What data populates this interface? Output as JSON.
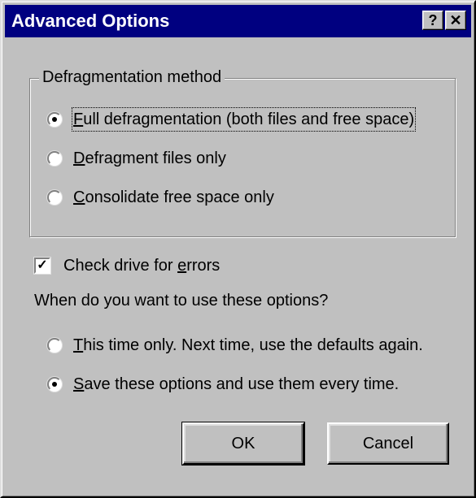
{
  "window": {
    "title": "Advanced Options",
    "help_label": "?",
    "close_label": "✕"
  },
  "method_group": {
    "legend": "Defragmentation method",
    "options": [
      {
        "accel": "F",
        "rest": "ull defragmentation (both files and free space)",
        "selected": true
      },
      {
        "accel": "D",
        "rest": "efragment files only",
        "selected": false
      },
      {
        "accel": "C",
        "rest": "onsolidate free space only",
        "selected": false
      }
    ]
  },
  "check_drive": {
    "label_before": "Check drive for ",
    "accel": "e",
    "label_after": "rrors",
    "checked": true,
    "check_glyph": "✓"
  },
  "when_prompt": "When do you want to use these options?",
  "when_options": [
    {
      "accel": "T",
      "rest": "his time only. Next time, use the defaults again.",
      "selected": false
    },
    {
      "accel": "S",
      "rest": "ave these options and use them every time.",
      "selected": true
    }
  ],
  "buttons": {
    "ok_label": "OK",
    "cancel_label": "Cancel"
  }
}
